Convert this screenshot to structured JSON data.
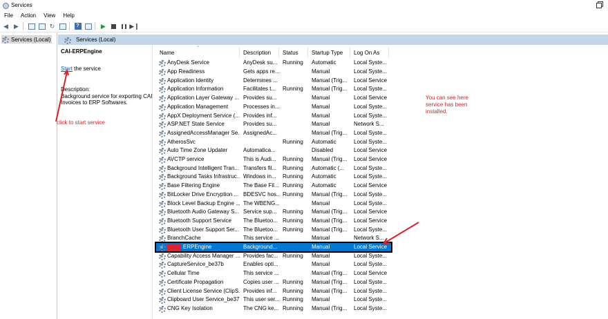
{
  "window": {
    "title": "Services"
  },
  "menu": {
    "items": [
      "File",
      "Action",
      "View",
      "Help"
    ]
  },
  "tree": {
    "item": "Services (Local)"
  },
  "band": {
    "title": "Services (Local)"
  },
  "desc": {
    "service_name": "CAI-ERPEngine",
    "start_link": "Start",
    "start_suffix": " the service",
    "label": "Description:",
    "text": "Background service for exporting CAI Invoices to ERP Softwares."
  },
  "columns": [
    "Name",
    "Description",
    "Status",
    "Startup Type",
    "Log On As"
  ],
  "rows": [
    [
      "AnyDesk Service",
      "AnyDesk su...",
      "Running",
      "Automatic",
      "Local Syste..."
    ],
    [
      "App Readiness",
      "Gets apps re...",
      "",
      "Manual",
      "Local Syste..."
    ],
    [
      "Application Identity",
      "Determines ...",
      "",
      "Manual (Trig...",
      "Local Service"
    ],
    [
      "Application Information",
      "Facilitates t...",
      "Running",
      "Manual (Trig...",
      "Local Syste..."
    ],
    [
      "Application Layer Gateway ...",
      "Provides su...",
      "",
      "Manual",
      "Local Service"
    ],
    [
      "Application Management",
      "Processes in...",
      "",
      "Manual",
      "Local Syste..."
    ],
    [
      "AppX Deployment Service (...",
      "Provides inf...",
      "",
      "Manual",
      "Local Syste..."
    ],
    [
      "ASP.NET State Service",
      "Provides su...",
      "",
      "Manual",
      "Network S..."
    ],
    [
      "AssignedAccessManager Se...",
      "AssignedAc...",
      "",
      "Manual (Trig...",
      "Local Syste..."
    ],
    [
      "AtherosSvc",
      "",
      "Running",
      "Automatic",
      "Local Syste..."
    ],
    [
      "Auto Time Zone Updater",
      "Automatica...",
      "",
      "Disabled",
      "Local Service"
    ],
    [
      "AVCTP service",
      "This is Audi...",
      "Running",
      "Manual (Trig...",
      "Local Service"
    ],
    [
      "Background Intelligent Tran...",
      "Transfers fil...",
      "Running",
      "Automatic (...",
      "Local Syste..."
    ],
    [
      "Background Tasks Infrastruc...",
      "Windows in...",
      "Running",
      "Automatic",
      "Local Syste..."
    ],
    [
      "Base Filtering Engine",
      "The Base Fil...",
      "Running",
      "Automatic",
      "Local Service"
    ],
    [
      "BitLocker Drive Encryption ...",
      "BDESVC hos...",
      "Running",
      "Manual (Trig...",
      "Local Syste..."
    ],
    [
      "Block Level Backup Engine ...",
      "The WBENG...",
      "",
      "Manual",
      "Local Syste..."
    ],
    [
      "Bluetooth Audio Gateway S...",
      "Service sup...",
      "Running",
      "Manual (Trig...",
      "Local Service"
    ],
    [
      "Bluetooth Support Service",
      "The Bluetoo...",
      "Running",
      "Manual (Trig...",
      "Local Service"
    ],
    [
      "Bluetooth User Support Ser...",
      "The Bluetoo...",
      "Running",
      "Manual (Trig...",
      "Local Syste..."
    ],
    [
      "BranchCache",
      "This service ...",
      "",
      "Manual",
      "Network S..."
    ],
    [
      "ERPEngine",
      "Background...",
      "",
      "Manual",
      "Local Service"
    ],
    [
      "Capability Access Manager ...",
      "Provides fac...",
      "Running",
      "Manual",
      "Local Syste..."
    ],
    [
      "CaptureService_be37b",
      "Enables opti...",
      "",
      "Manual",
      "Local Syste..."
    ],
    [
      "Cellular Time",
      "This service ...",
      "",
      "Manual (Trig...",
      "Local Service"
    ],
    [
      "Certificate Propagation",
      "Copies user ...",
      "Running",
      "Manual (Trig...",
      "Local Syste..."
    ],
    [
      "Client License Service (ClipS...",
      "Provides inf...",
      "Running",
      "Manual (Trig...",
      "Local Syste..."
    ],
    [
      "Clipboard User Service_be37b",
      "This user ser...",
      "Running",
      "Manual",
      "Local Syste..."
    ],
    [
      "CNG Key Isolation",
      "The CNG ke...",
      "Running",
      "Manual (Trig...",
      "Local Syste..."
    ]
  ],
  "selected_row_index": 21,
  "annotations": {
    "left_note": "click to start service",
    "right_note_line1": "You can see here",
    "right_note_line2": "service has been",
    "right_note_line3": "installed."
  },
  "colors": {
    "selection": "#0078d7",
    "annotation": "#e02020",
    "band": "#c3d7e8",
    "link": "#0b5fc7"
  }
}
